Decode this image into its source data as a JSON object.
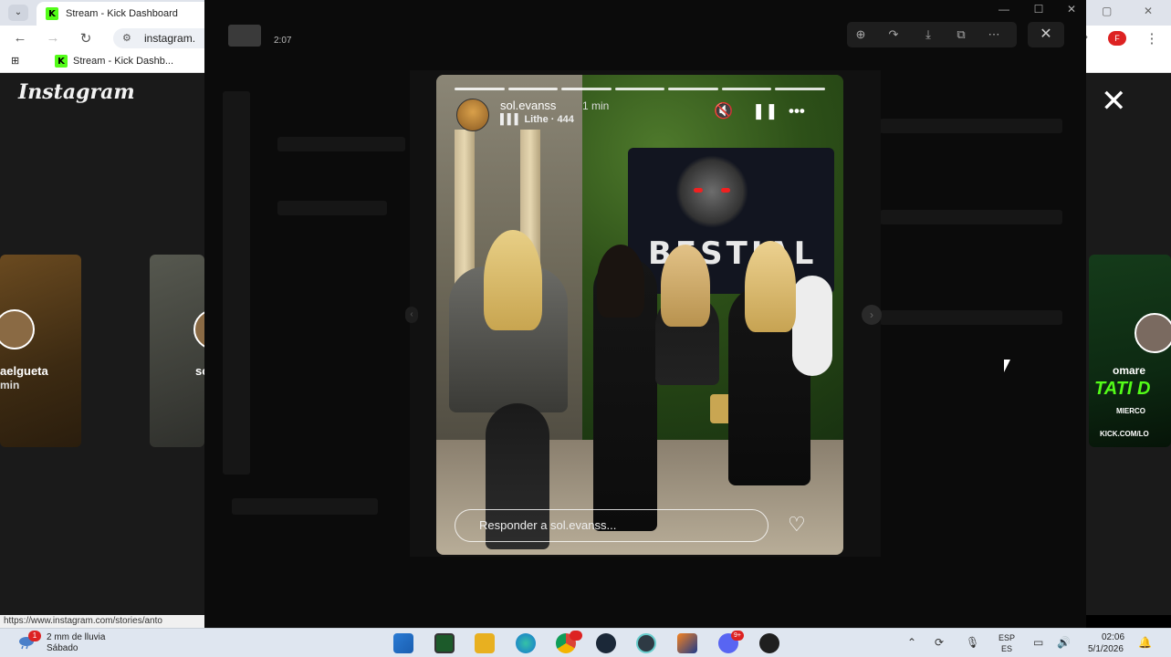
{
  "browser": {
    "tab_title": "Stream - Kick Dashboard",
    "kick_logo": "K",
    "url": "instagram.",
    "bookmark_label": "Stream - Kick Dashb...",
    "profile_initial": "F",
    "status_url": "https://www.instagram.com/stories/anto"
  },
  "instagram": {
    "logo": "Instagram",
    "left_card": {
      "name": "aelgueta",
      "time": "min"
    },
    "mid_card": {
      "name": "so"
    },
    "right_card": {
      "name": "omare",
      "title": "TATI D",
      "sub": "MIERCO",
      "link": "KICK.COM/LO"
    }
  },
  "viewer": {
    "time": "2:07",
    "toolbar_icons": [
      "zoom-in-icon",
      "share-icon",
      "download-icon",
      "open-external-icon",
      "more-icon"
    ],
    "close_glyph": "✕"
  },
  "story": {
    "username": "sol.evanss",
    "time": "1 min",
    "music": "Lithe · 444",
    "reply_placeholder": "Responder a sol.evanss...",
    "segments": 7,
    "sign_text": "BESTIAL"
  },
  "taskbar": {
    "weather_text": "2 mm de lluvia",
    "weather_day": "Sábado",
    "weather_badge": "1",
    "lang_top": "ESP",
    "lang_bottom": "ES",
    "time": "02:06",
    "date": "5/1/2026",
    "chrome_badge": "",
    "discord_badge": "9+"
  },
  "colors": {
    "kick_green": "#53fc18",
    "taskbar_bg": "#dfe6f0",
    "ig_bg": "#1a1a1a"
  }
}
